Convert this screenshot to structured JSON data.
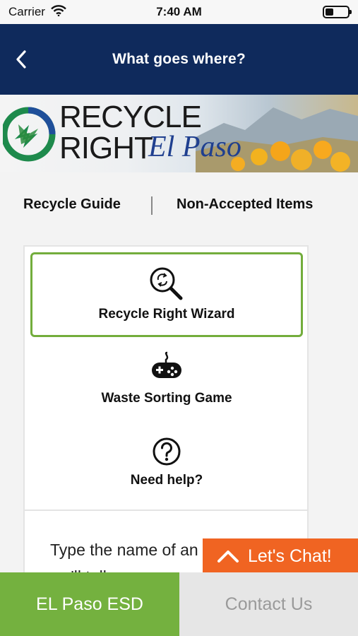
{
  "status_bar": {
    "carrier": "Carrier",
    "time": "7:40 AM",
    "battery_level": 0.35
  },
  "nav": {
    "title": "What goes where?"
  },
  "banner": {
    "line1": "RECYCLE",
    "line2": "RIGHT",
    "line3": "El Paso"
  },
  "tabs": [
    {
      "label": "Recycle Guide"
    },
    {
      "label": "Non-Accepted Items"
    }
  ],
  "options": [
    {
      "label": "Recycle Right Wizard",
      "icon": "recycle-search-icon",
      "selected": true
    },
    {
      "label": "Waste Sorting Game",
      "icon": "gamepad-icon",
      "selected": false
    },
    {
      "label": "Need help?",
      "icon": "question-circle-icon",
      "selected": false
    }
  ],
  "card_text": "Type the name of an item and we'll tell you",
  "chat": {
    "label": "Let's Chat!"
  },
  "footer": {
    "left": "EL Paso ESD",
    "right": "Contact Us"
  },
  "colors": {
    "nav": "#0f2a5c",
    "accent_green": "#74b13f",
    "chat_orange": "#f06422"
  }
}
